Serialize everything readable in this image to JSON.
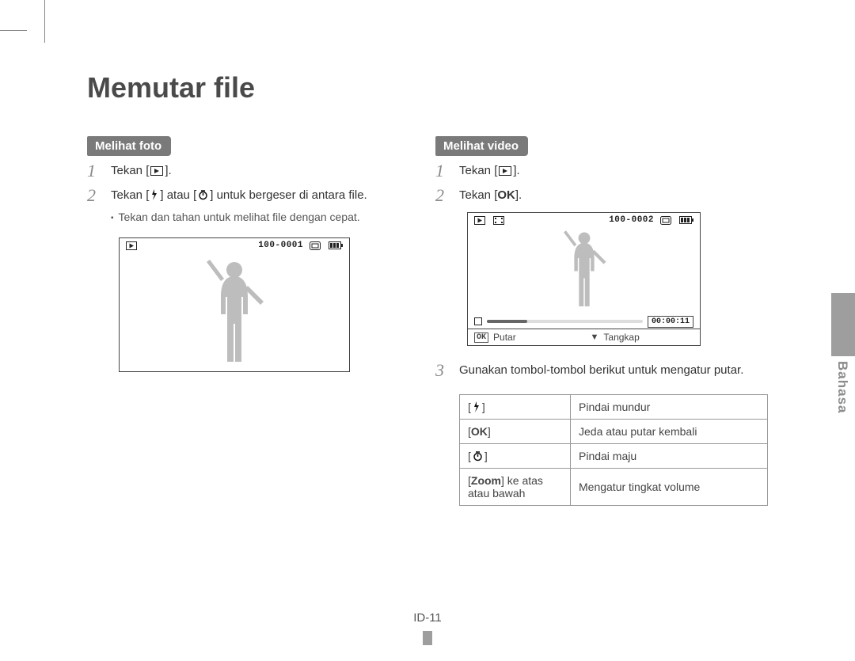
{
  "title": "Memutar file",
  "side_language": "Bahasa",
  "page_number": "ID-11",
  "photo": {
    "section_label": "Melihat foto",
    "step1": "Tekan [",
    "step1_end": "].",
    "step2_pre": "Tekan [",
    "step2_mid": "] atau [",
    "step2_post": "] untuk bergeser di antara file.",
    "bullet": "Tekan dan tahan untuk melihat file dengan cepat.",
    "counter": "100-0001"
  },
  "video": {
    "section_label": "Melihat video",
    "step1": "Tekan [",
    "step1_end": "].",
    "step2": "Tekan [",
    "step2_end": "].",
    "step3": "Gunakan tombol-tombol berikut untuk mengatur putar.",
    "counter": "100-0002",
    "time": "00:00:11",
    "cap_left_label": "Putar",
    "cap_right_label": "Tangkap"
  },
  "controls": {
    "r1_desc": "Pindai mundur",
    "r2_label": "OK",
    "r2_desc": "Jeda atau putar kembali",
    "r3_desc": "Pindai maju",
    "r4_label_pre": "[",
    "r4_zoom": "Zoom",
    "r4_label_post": "] ke atas atau bawah",
    "r4_desc": "Mengatur tingkat volume"
  }
}
